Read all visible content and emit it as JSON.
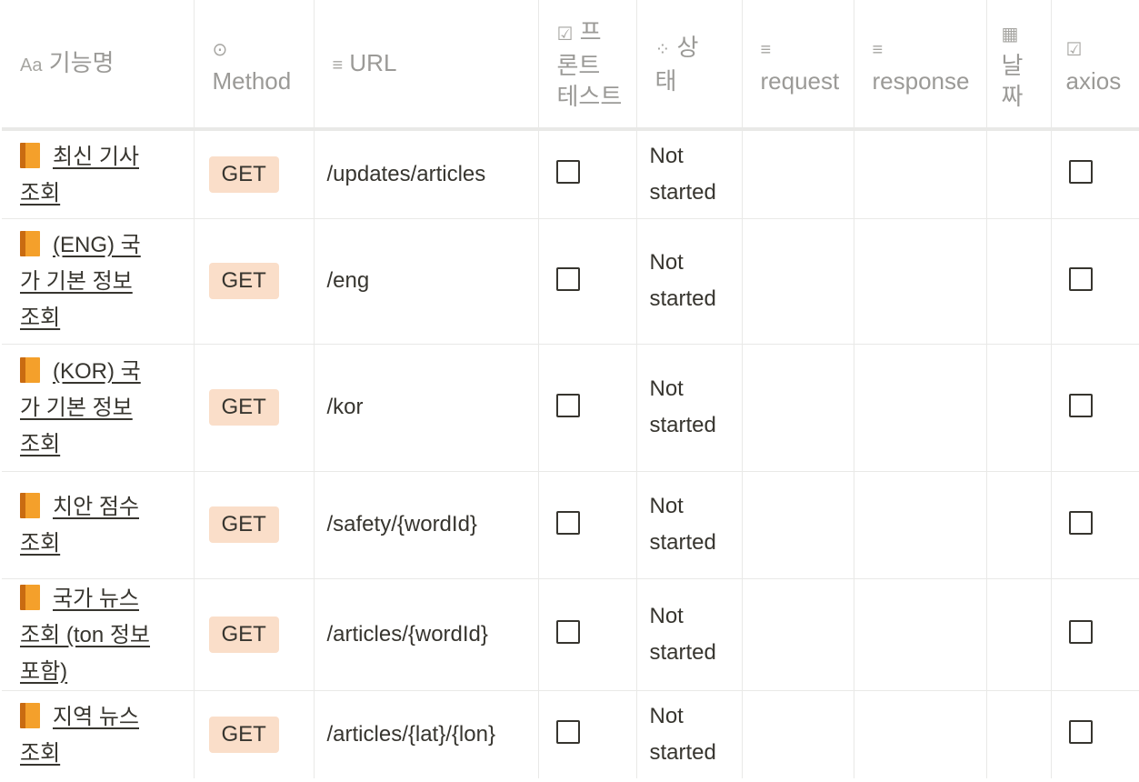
{
  "headers": {
    "name": {
      "icon": "text-type-icon",
      "glyph": "Aa",
      "label": "기능명"
    },
    "method": {
      "icon": "select-icon",
      "glyph": "⊙",
      "label": "Method"
    },
    "url": {
      "icon": "text-lines-icon",
      "glyph": "≡",
      "label": "URL"
    },
    "front_test": {
      "icon": "checkbox-icon",
      "glyph": "☑",
      "line1": "프",
      "line2": "론트",
      "line3": "테스트"
    },
    "status": {
      "icon": "status-spinner-icon",
      "glyph": "⁘",
      "line1": "상",
      "line2": "태"
    },
    "request": {
      "icon": "text-lines-icon",
      "glyph": "≡",
      "label": "request"
    },
    "response": {
      "icon": "text-lines-icon",
      "glyph": "≡",
      "label": "response"
    },
    "date": {
      "icon": "calendar-icon",
      "glyph": "▦",
      "line1": "날",
      "line2": "짜"
    },
    "axios": {
      "icon": "checkbox-icon",
      "glyph": "☑",
      "label": "axios"
    }
  },
  "rows": [
    {
      "line1": "최신 기사",
      "line2": "조회",
      "line3": "",
      "method": "GET",
      "url": "/updates/articles",
      "status1": "Not",
      "status2": "started"
    },
    {
      "line1": "(ENG) 국",
      "line2": "가 기본 정보",
      "line3": "조회",
      "method": "GET",
      "url": "/eng",
      "status1": "Not",
      "status2": "started"
    },
    {
      "line1": "(KOR) 국",
      "line2": "가 기본 정보",
      "line3": "조회",
      "method": "GET",
      "url": "/kor",
      "status1": "Not",
      "status2": "started"
    },
    {
      "line1": "치안 점수",
      "line2": "조회",
      "line3": "",
      "method": "GET",
      "url": "/safety/{wordId}",
      "status1": "Not",
      "status2": "started"
    },
    {
      "line1": "국가 뉴스",
      "line2": "조회 (ton 정보",
      "line3": "포함)",
      "method": "GET",
      "url": "/articles/{wordId}",
      "status1": "Not",
      "status2": "started"
    },
    {
      "line1": "지역 뉴스",
      "line2": "조회",
      "line3": "",
      "method": "GET",
      "url": "/articles/{lat}/{lon}",
      "status1": "Not",
      "status2": "started"
    }
  ],
  "colors": {
    "method_badge_bg": "#fadec9",
    "border": "#e9e9e7",
    "header_text": "#9b9a97",
    "book_icon": "#f4a02b"
  }
}
